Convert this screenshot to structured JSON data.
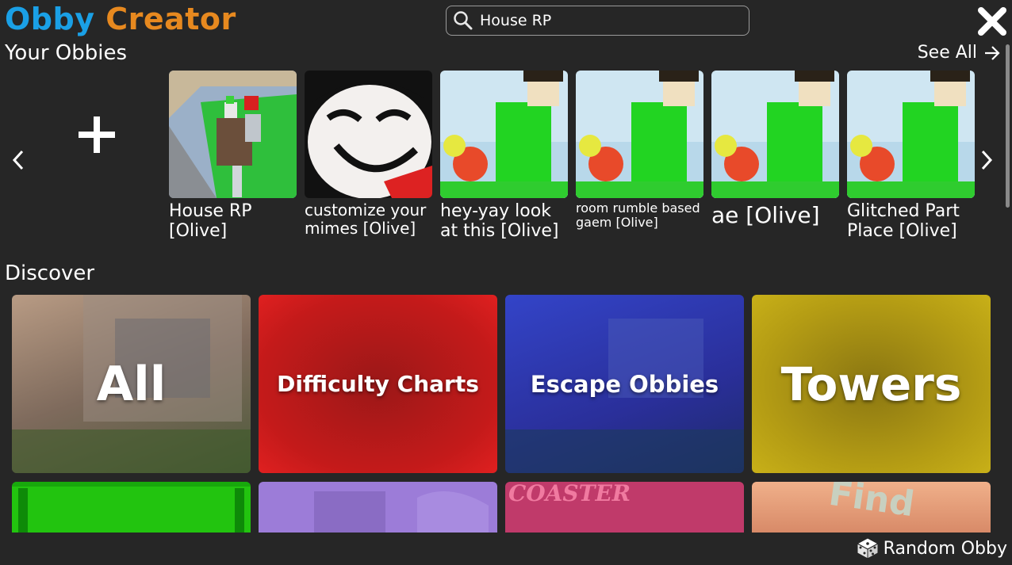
{
  "header": {
    "logo_part1": "Obby",
    "logo_part2": "Creator",
    "logo_colors": {
      "obby": "#1aa0e6",
      "creator": "#e7891f"
    },
    "search_value": "House RP",
    "close_icon": "close-icon"
  },
  "your_obbies": {
    "title": "Your Obbies",
    "see_all": "See All",
    "add_icon": "plus-icon",
    "items": [
      {
        "label": "House RP [Olive]",
        "thumb": "roblox-house-scene"
      },
      {
        "label": "customize your mimes [Olive]",
        "thumb": "smiling-cartoon-face"
      },
      {
        "label": "hey-yay look at this [Olive]",
        "thumb": "roblox-character-green"
      },
      {
        "label": "room rumble based gaem [Olive]",
        "thumb": "roblox-character-green"
      },
      {
        "label": "ae [Olive]",
        "thumb": "roblox-character-green"
      },
      {
        "label": "Glitched Part Place [Olive]",
        "thumb": "roblox-character-green"
      }
    ]
  },
  "discover": {
    "title": "Discover",
    "categories": [
      {
        "label": "All",
        "color": "#8a7a6a"
      },
      {
        "label": "Difficulty Charts",
        "color": "#b01818"
      },
      {
        "label": "Escape Obbies",
        "color": "#2a2fa8"
      },
      {
        "label": "Towers",
        "color": "#b8a01a"
      }
    ],
    "second_row": [
      {
        "label": "",
        "color": "#22c40f"
      },
      {
        "label": "",
        "color": "#9c7cd8"
      },
      {
        "label": "COASTER",
        "color": "#c03a6a"
      },
      {
        "label": "Find",
        "color": "#e8a07a"
      }
    ]
  },
  "footer": {
    "random_obby": "Random Obby",
    "dice_icon": "dice-icon"
  }
}
